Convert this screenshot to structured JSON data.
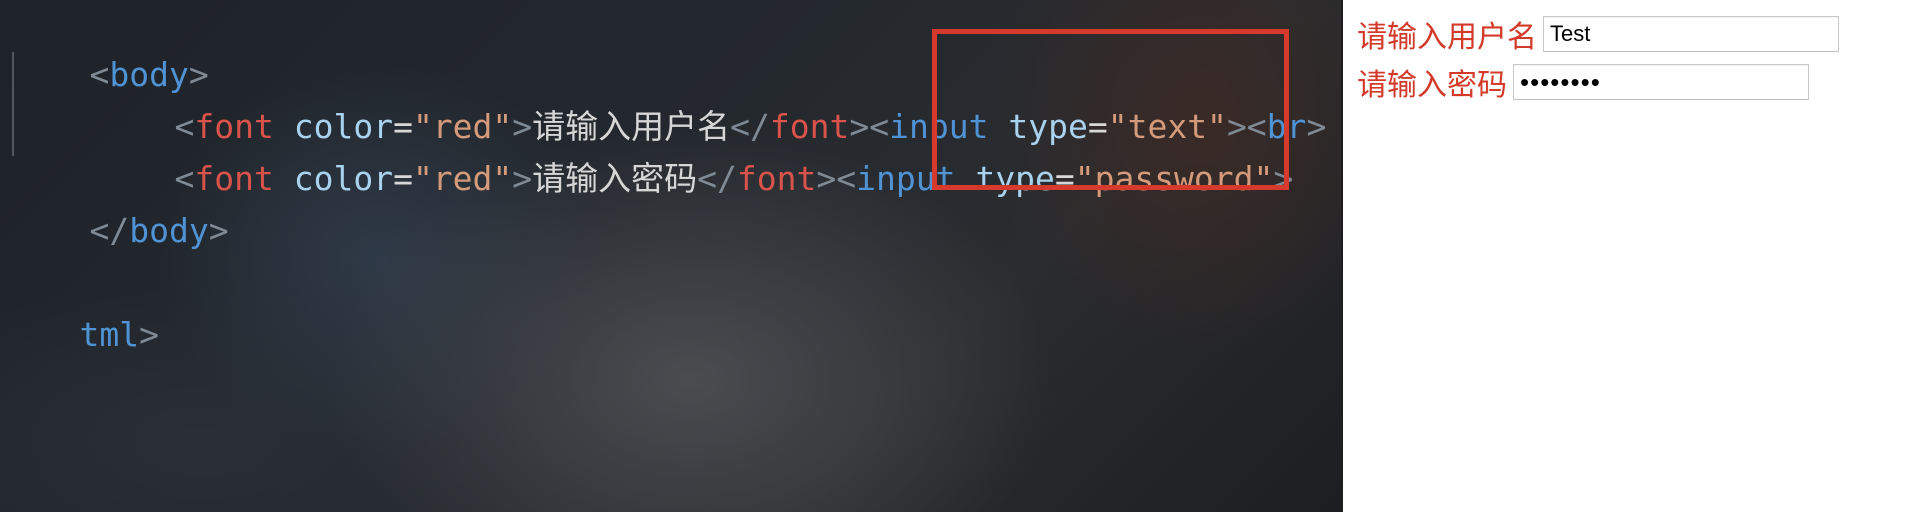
{
  "editor": {
    "body_open": "body",
    "body_close": "body",
    "html_close": "tml",
    "font_tag": "font",
    "color_attr": "color",
    "color_value": "\"red\"",
    "input_tag": "input",
    "type_attr": "type",
    "type_text": "\"text\"",
    "type_password": "\"password\"",
    "br_tag": "br",
    "label_username": "请输入用户名",
    "label_password": "请输入密码"
  },
  "colors": {
    "highlight_box": "#d63a2c",
    "label_red": "#d33a2a"
  },
  "preview": {
    "username_label": "请输入用户名",
    "username_value": "Test",
    "password_label": "请输入密码",
    "password_value": "••••••••"
  }
}
